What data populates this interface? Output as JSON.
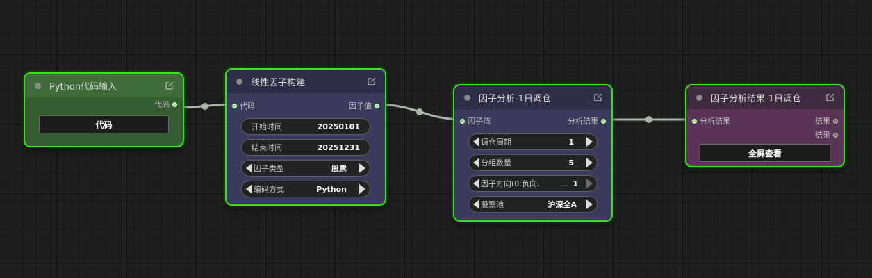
{
  "colors": {
    "selected_border": "#39e21c",
    "link": "#aab8aa",
    "slot_connected": "#9be88d",
    "python_node_title": "#3f6b3a",
    "python_node_body": "#365c32",
    "factor_node_title": "#2f2e48",
    "factor_node_body": "#3a3a5c",
    "result_node_title": "#3e2b3e",
    "result_node_body": "#5a3557"
  },
  "nodes": {
    "python_input": {
      "title": "Python代码输入",
      "output_label": "代码",
      "widget_value": "代码"
    },
    "linear_factor": {
      "title": "线性因子构建",
      "input_label": "代码",
      "output_label": "因子值",
      "widgets": [
        {
          "label": "开始时间",
          "value": "20250101"
        },
        {
          "label": "结束时间",
          "value": "20251231"
        },
        {
          "label": "因子类型",
          "value": "股票"
        },
        {
          "label": "编码方式",
          "value": "Python"
        }
      ]
    },
    "factor_analysis": {
      "title": "因子分析-1日调仓",
      "input_label": "因子值",
      "output_label": "分析结果",
      "widgets": [
        {
          "label": "调仓周期",
          "value": "1"
        },
        {
          "label": "分组数量",
          "value": "5"
        },
        {
          "label": "因子方向(0:负向,",
          "ellipsis": "…",
          "value": "1"
        },
        {
          "label": "股票池",
          "value": "沪深全A"
        }
      ]
    },
    "analysis_result": {
      "title": "因子分析结果-1日调仓",
      "input_label": "分析结果",
      "output_labels": [
        "结果",
        "结果"
      ],
      "button_label": "全屏查看"
    }
  }
}
